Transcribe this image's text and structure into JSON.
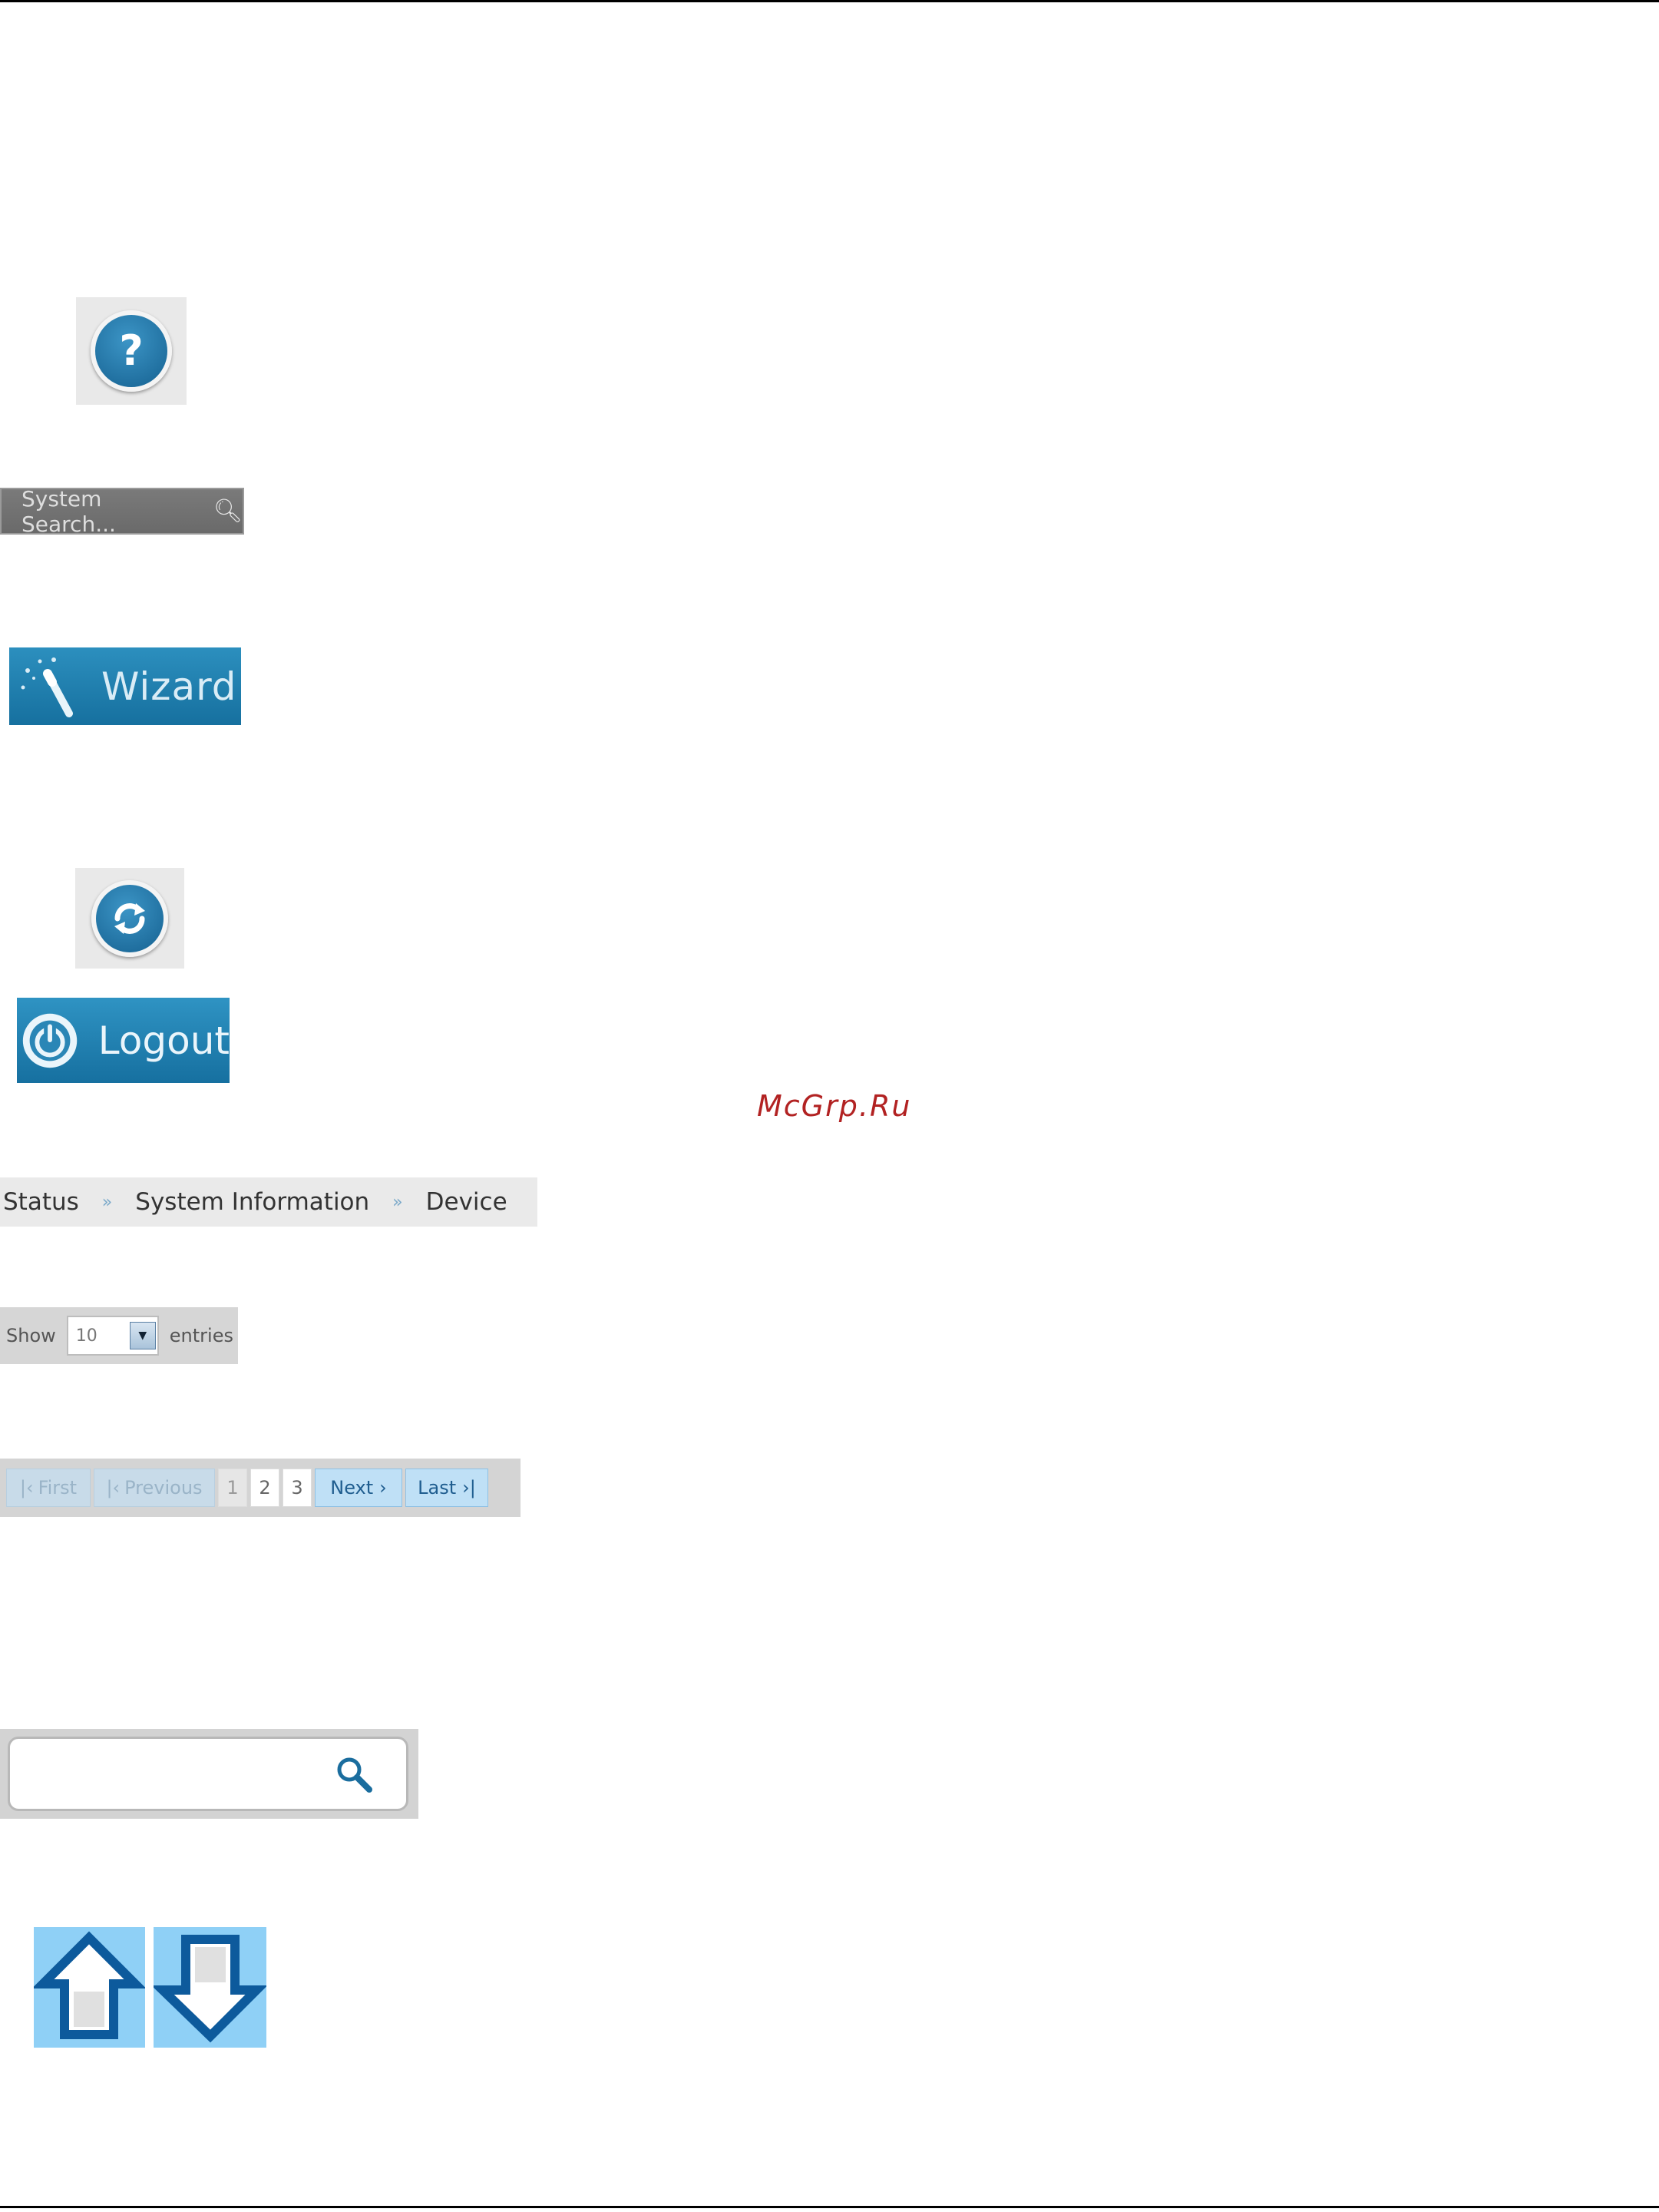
{
  "help_button": {
    "glyph": "?",
    "icon": "question-icon"
  },
  "system_search": {
    "placeholder": "System Search...",
    "icon": "search-icon"
  },
  "wizard_button": {
    "label": "Wizard",
    "icon": "magic-wand-icon"
  },
  "refresh_button": {
    "icon": "refresh-icon"
  },
  "logout_button": {
    "label": "Logout",
    "icon": "power-icon"
  },
  "watermark": "McGrp.Ru",
  "breadcrumb": {
    "items": [
      "Status",
      "System Information",
      "Device"
    ],
    "separator": "»"
  },
  "show_entries": {
    "prefix": "Show",
    "value": "10",
    "suffix": "entries"
  },
  "pagination": {
    "first": "First",
    "previous": "Previous",
    "pages": [
      "1",
      "2",
      "3"
    ],
    "current_page": "1",
    "next": "Next",
    "last": "Last"
  },
  "search_field": {
    "value": "",
    "icon": "search-icon"
  },
  "arrows": {
    "up": "up-arrow-icon",
    "down": "down-arrow-icon"
  },
  "colors": {
    "accent_blue": "#1f79ab",
    "tile_gray": "#e9e9e9",
    "arrow_tile_blue": "#8fd0f6",
    "watermark_red": "#b22222"
  }
}
